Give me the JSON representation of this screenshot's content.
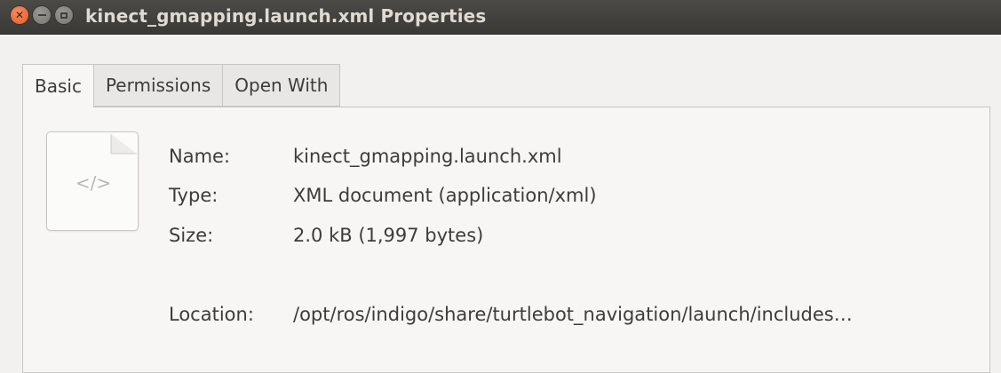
{
  "window": {
    "title": "kinect_gmapping.launch.xml Properties",
    "close_glyph": "✕"
  },
  "tabs": [
    {
      "label": "Basic",
      "active": true
    },
    {
      "label": "Permissions",
      "active": false
    },
    {
      "label": "Open With",
      "active": false
    }
  ],
  "file_icon": {
    "icon": "xml-file-icon",
    "glyph": "</>"
  },
  "properties": {
    "name_label": "Name:",
    "name_value": "kinect_gmapping.launch.xml",
    "type_label": "Type:",
    "type_value": "XML document (application/xml)",
    "size_label": "Size:",
    "size_value": "2.0 kB (1,997 bytes)",
    "location_label": "Location:",
    "location_value": "/opt/ros/indigo/share/turtlebot_navigation/launch/includes…"
  }
}
